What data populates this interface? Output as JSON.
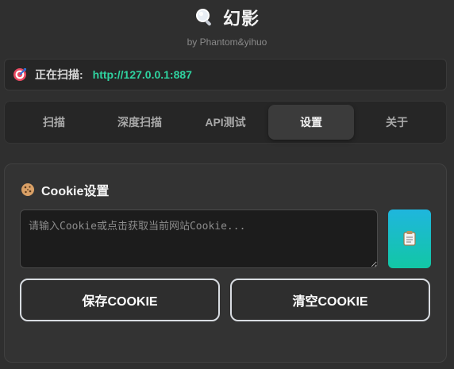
{
  "header": {
    "app_title": "幻影",
    "subtitle": "by Phantom&yihuo",
    "logo_icon": "magnifier-icon"
  },
  "status": {
    "icon": "target-icon",
    "label": "正在扫描:",
    "url": "http://127.0.0.1:887"
  },
  "tabs": [
    {
      "label": "扫描",
      "active": false
    },
    {
      "label": "深度扫描",
      "active": false
    },
    {
      "label": "API测试",
      "active": false
    },
    {
      "label": "设置",
      "active": true
    },
    {
      "label": "关于",
      "active": false
    }
  ],
  "settings": {
    "cookie_section": {
      "icon": "cookie-icon",
      "title": "Cookie设置",
      "input_value": "",
      "input_placeholder": "请输入Cookie或点击获取当前网站Cookie...",
      "grab_button_icon": "clipboard-icon",
      "save_label": "保存COOKIE",
      "clear_label": "清空COOKIE"
    }
  },
  "colors": {
    "background": "#2f2f2f",
    "url_accent": "#2fd3a0",
    "grab_button_gradient_top": "#1fb6dd",
    "grab_button_gradient_bottom": "#12c7a5"
  }
}
